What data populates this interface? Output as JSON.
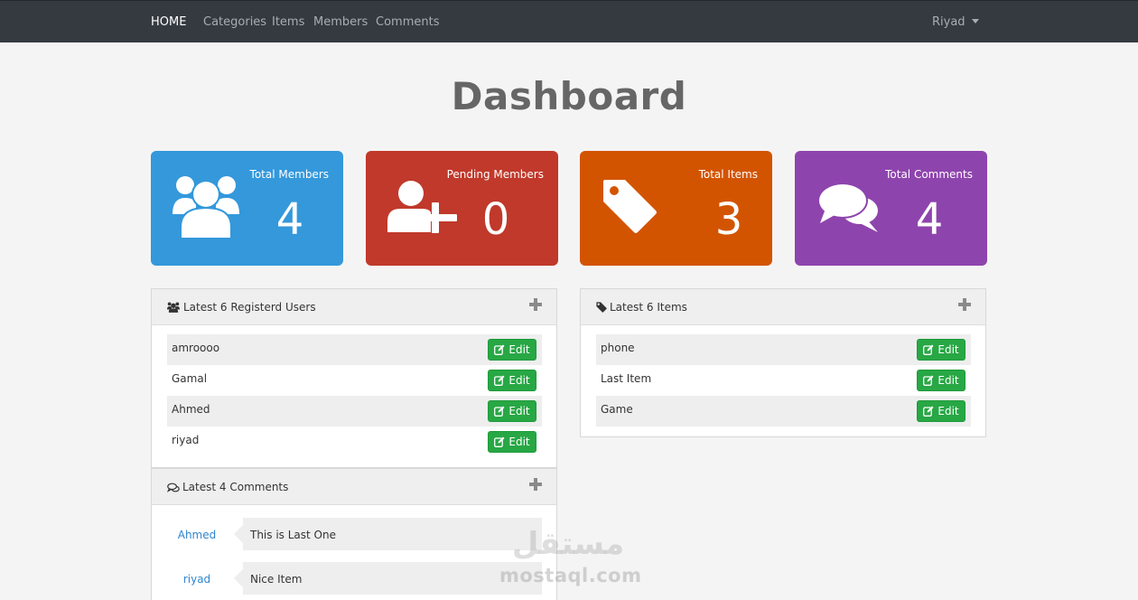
{
  "nav": {
    "home": "HOME",
    "categories": "Categories",
    "items": "Items",
    "members": "Members",
    "comments": "Comments",
    "user": "Riyad"
  },
  "page_title": "Dashboard",
  "stats": [
    {
      "label": "Total Members",
      "value": "4",
      "color": "#3498db",
      "icon": "users-icon"
    },
    {
      "label": "Pending Members",
      "value": "0",
      "color": "#c0392b",
      "icon": "user-plus-icon"
    },
    {
      "label": "Total Items",
      "value": "3",
      "color": "#d35400",
      "icon": "tag-icon"
    },
    {
      "label": "Total Comments",
      "value": "4",
      "color": "#8e44ad",
      "icon": "comments-icon"
    }
  ],
  "latest_users": {
    "title": "Latest 6 Registerd Users",
    "edit_label": "Edit",
    "rows": [
      "amroooo",
      "Gamal",
      "Ahmed",
      "riyad"
    ]
  },
  "latest_items": {
    "title": "Latest 6 Items",
    "edit_label": "Edit",
    "rows": [
      "phone",
      "Last Item",
      "Game"
    ]
  },
  "latest_comments": {
    "title": "Latest 4 Comments",
    "rows": [
      {
        "user": "Ahmed",
        "text": "This is Last One"
      },
      {
        "user": "riyad",
        "text": "Nice Item"
      }
    ]
  },
  "watermark": {
    "arabic": "مستقل",
    "text": "mostaql.com"
  }
}
